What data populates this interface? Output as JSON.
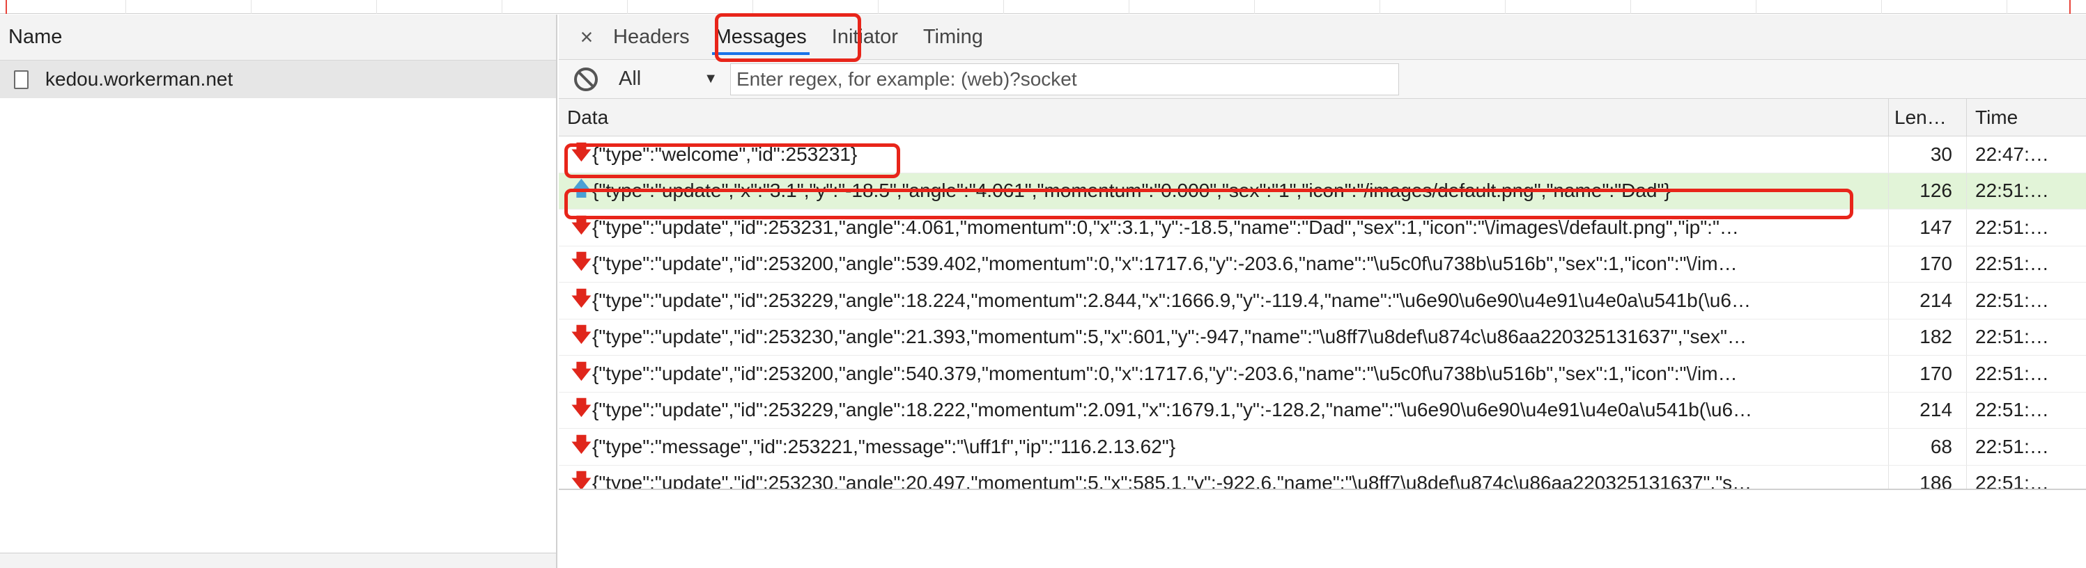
{
  "left_panel": {
    "column_header": "Name",
    "requests": [
      {
        "name": "kedou.workerman.net",
        "icon": "document-icon"
      }
    ]
  },
  "tabs": {
    "close_icon": "×",
    "items": [
      {
        "label": "Headers",
        "active": false
      },
      {
        "label": "Messages",
        "active": true
      },
      {
        "label": "Initiator",
        "active": false
      },
      {
        "label": "Timing",
        "active": false
      }
    ]
  },
  "filter": {
    "block_icon": "block-icon",
    "selected": "All",
    "caret": "▼",
    "regex_placeholder": "Enter regex, for example: (web)?socket",
    "regex_value": ""
  },
  "table": {
    "headers": {
      "data": "Data",
      "length": "Len…",
      "time": "Time"
    },
    "rows": [
      {
        "direction": "received",
        "arrow": "🡇",
        "data": "{\"type\":\"welcome\",\"id\":253231}",
        "length": "30",
        "time": "22:47:…"
      },
      {
        "direction": "sent",
        "arrow": "🡅",
        "data": "{\"type\":\"update\",\"x\":\"3.1\",\"y\":\"-18.5\",\"angle\":\"4.061\",\"momentum\":\"0.000\",\"sex\":\"1\",\"icon\":\"/images/default.png\",\"name\":\"Dad\"}",
        "length": "126",
        "time": "22:51:…"
      },
      {
        "direction": "received",
        "arrow": "🡇",
        "data": "{\"type\":\"update\",\"id\":253231,\"angle\":4.061,\"momentum\":0,\"x\":3.1,\"y\":-18.5,\"name\":\"Dad\",\"sex\":1,\"icon\":\"\\/images\\/default.png\",\"ip\":\"…",
        "length": "147",
        "time": "22:51:…"
      },
      {
        "direction": "received",
        "arrow": "🡇",
        "data": "{\"type\":\"update\",\"id\":253200,\"angle\":539.402,\"momentum\":0,\"x\":1717.6,\"y\":-203.6,\"name\":\"\\u5c0f\\u738b\\u516b\",\"sex\":1,\"icon\":\"\\/im…",
        "length": "170",
        "time": "22:51:…"
      },
      {
        "direction": "received",
        "arrow": "🡇",
        "data": "{\"type\":\"update\",\"id\":253229,\"angle\":18.224,\"momentum\":2.844,\"x\":1666.9,\"y\":-119.4,\"name\":\"\\u6e90\\u6e90\\u4e91\\u4e0a\\u541b(\\u6…",
        "length": "214",
        "time": "22:51:…"
      },
      {
        "direction": "received",
        "arrow": "🡇",
        "data": "{\"type\":\"update\",\"id\":253230,\"angle\":21.393,\"momentum\":5,\"x\":601,\"y\":-947,\"name\":\"\\u8ff7\\u8def\\u874c\\u86aa220325131637\",\"sex\"…",
        "length": "182",
        "time": "22:51:…"
      },
      {
        "direction": "received",
        "arrow": "🡇",
        "data": "{\"type\":\"update\",\"id\":253200,\"angle\":540.379,\"momentum\":0,\"x\":1717.6,\"y\":-203.6,\"name\":\"\\u5c0f\\u738b\\u516b\",\"sex\":1,\"icon\":\"\\/im…",
        "length": "170",
        "time": "22:51:…"
      },
      {
        "direction": "received",
        "arrow": "🡇",
        "data": "{\"type\":\"update\",\"id\":253229,\"angle\":18.222,\"momentum\":2.091,\"x\":1679.1,\"y\":-128.2,\"name\":\"\\u6e90\\u6e90\\u4e91\\u4e0a\\u541b(\\u6…",
        "length": "214",
        "time": "22:51:…"
      },
      {
        "direction": "received",
        "arrow": "🡇",
        "data": "{\"type\":\"message\",\"id\":253221,\"message\":\"\\uff1f\",\"ip\":\"116.2.13.62\"}",
        "length": "68",
        "time": "22:51:…"
      },
      {
        "direction": "received",
        "arrow": "🡇",
        "data": "{\"type\":\"update\",\"id\":253230,\"angle\":20.497,\"momentum\":5,\"x\":585.1,\"y\":-922.6,\"name\":\"\\u8ff7\\u8def\\u874c\\u86aa220325131637\",\"s…",
        "length": "186",
        "time": "22:51:…"
      }
    ]
  },
  "colors": {
    "highlight_red": "#e8251a",
    "sent_row_bg": "#e2f4d8",
    "received_arrow": "#e0261b",
    "sent_arrow": "#4aa0d5",
    "active_tab_underline": "#1a73e8"
  }
}
